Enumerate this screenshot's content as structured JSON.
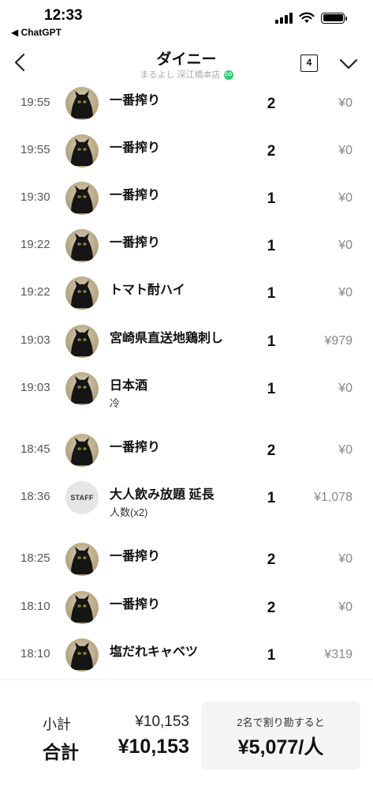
{
  "status_bar": {
    "time": "12:33",
    "back_app": "◀ ChatGPT"
  },
  "header": {
    "title": "ダイニー",
    "store": "まるよし 深江橋本店",
    "badge": "CO",
    "tab_count": "4"
  },
  "orders": [
    {
      "time": "19:55",
      "avatar": "cat",
      "name": "一番搾り",
      "note": "",
      "qty": "2",
      "price": "¥0"
    },
    {
      "time": "19:55",
      "avatar": "cat",
      "name": "一番搾り",
      "note": "",
      "qty": "2",
      "price": "¥0"
    },
    {
      "time": "19:30",
      "avatar": "cat",
      "name": "一番搾り",
      "note": "",
      "qty": "1",
      "price": "¥0"
    },
    {
      "time": "19:22",
      "avatar": "cat",
      "name": "一番搾り",
      "note": "",
      "qty": "1",
      "price": "¥0"
    },
    {
      "time": "19:22",
      "avatar": "cat",
      "name": "トマト酎ハイ",
      "note": "",
      "qty": "1",
      "price": "¥0"
    },
    {
      "time": "19:03",
      "avatar": "cat",
      "name": "宮崎県直送地鶏刺し",
      "note": "",
      "qty": "1",
      "price": "¥979"
    },
    {
      "time": "19:03",
      "avatar": "cat",
      "name": "日本酒",
      "note": "冷",
      "qty": "1",
      "price": "¥0"
    },
    {
      "time": "18:45",
      "avatar": "cat",
      "name": "一番搾り",
      "note": "",
      "qty": "2",
      "price": "¥0"
    },
    {
      "time": "18:36",
      "avatar": "STAFF",
      "name": "大人飲み放題 延長",
      "note": "人数(x2)",
      "qty": "1",
      "price": "¥1,078"
    },
    {
      "time": "18:25",
      "avatar": "cat",
      "name": "一番搾り",
      "note": "",
      "qty": "2",
      "price": "¥0"
    },
    {
      "time": "18:10",
      "avatar": "cat",
      "name": "一番搾り",
      "note": "",
      "qty": "2",
      "price": "¥0"
    },
    {
      "time": "18:10",
      "avatar": "cat",
      "name": "塩だれキャベツ",
      "note": "",
      "qty": "1",
      "price": "¥319"
    }
  ],
  "footer": {
    "subtotal_label": "小計",
    "subtotal_value": "¥10,153",
    "total_label": "合計",
    "total_value": "¥10,153",
    "split_label": "2名で割り勘すると",
    "split_value": "¥5,077/人"
  }
}
